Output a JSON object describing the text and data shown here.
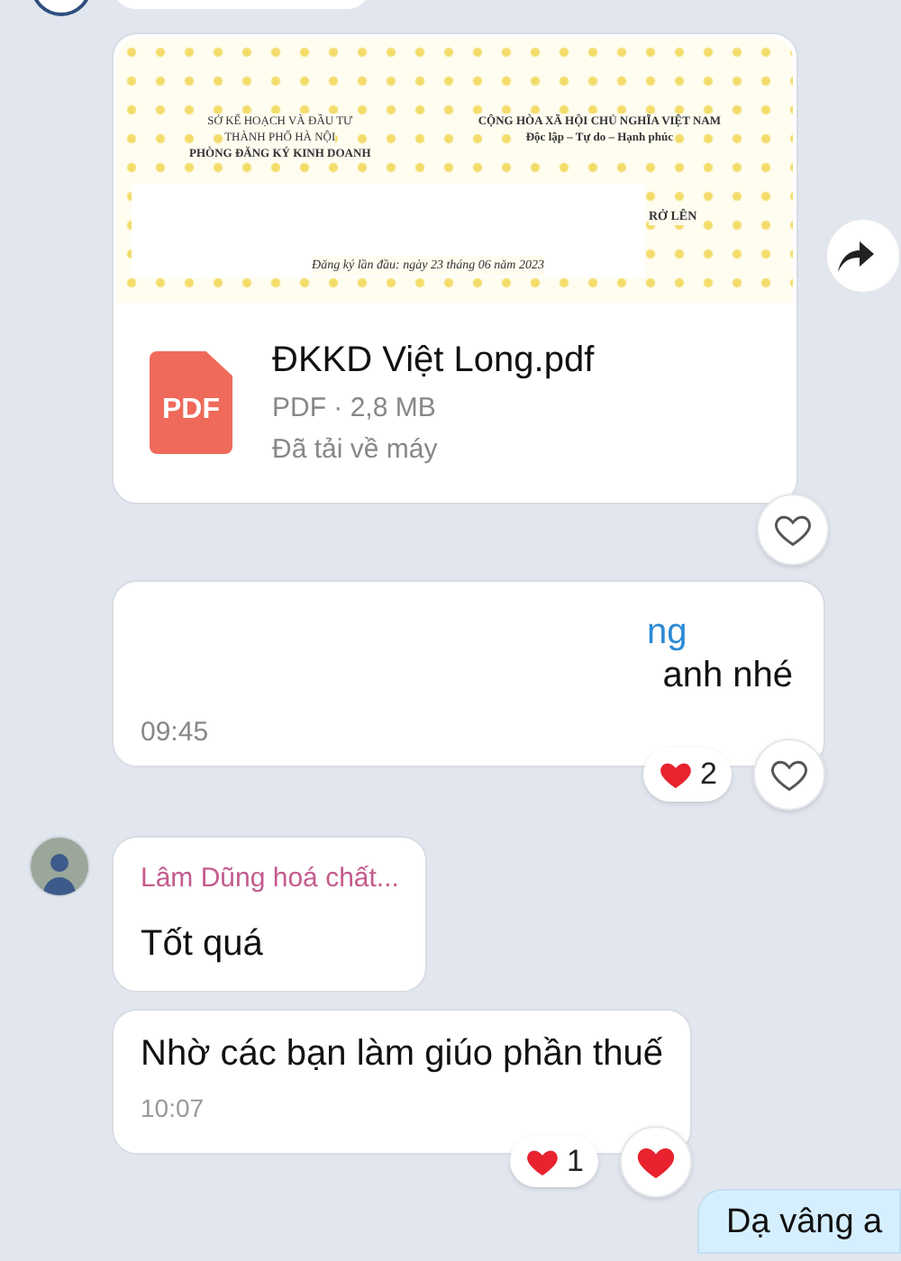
{
  "file_message": {
    "preview": {
      "left_lines": [
        "SỞ KẾ HOẠCH VÀ ĐẦU TƯ",
        "THÀNH PHỐ HÀ NỘI",
        "PHÒNG ĐĂNG KÝ KINH DOANH"
      ],
      "right_lines": [
        "CỘNG HÒA XÃ HỘI CHỦ NGHĨA VIỆT NAM",
        "Độc lập – Tự do – Hạnh phúc"
      ],
      "fragment": "RỞ LÊN",
      "date_line": "Đăng ký lần đầu: ngày 23 tháng 06 năm 2023"
    },
    "file_type": "PDF",
    "file_name": "ĐKKD Việt Long.pdf",
    "meta": "PDF · 2,8 MB",
    "status": "Đã tải về máy",
    "liked": false
  },
  "messages": [
    {
      "kind": "partial",
      "lines": [
        {
          "text": "ng",
          "link": true
        },
        {
          "text": "anh nhé",
          "link": false
        }
      ],
      "time": "09:45",
      "reaction_count": "2",
      "liked": false
    },
    {
      "kind": "received",
      "sender": "Lâm Dũng hoá chất...",
      "text": "Tốt quá"
    },
    {
      "kind": "received",
      "text": "Nhờ các bạn làm giúo phần thuế",
      "time": "10:07",
      "reaction_count": "1",
      "liked": true
    },
    {
      "kind": "sent",
      "text": "Dạ vâng a"
    }
  ]
}
